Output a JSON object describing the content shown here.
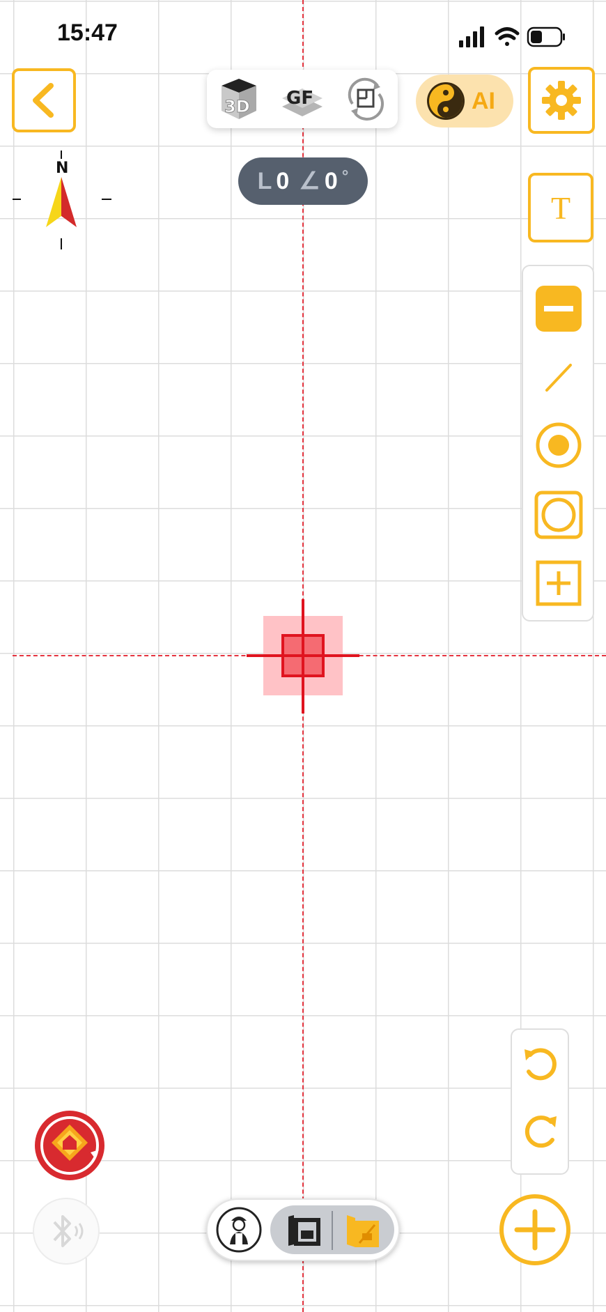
{
  "status_bar": {
    "time": "15:47",
    "icons": [
      "signal-icon",
      "wifi-icon",
      "battery-icon"
    ]
  },
  "header": {
    "back_icon": "chevron-left-icon",
    "modes": [
      {
        "name": "3d-view",
        "label": "3D"
      },
      {
        "name": "gf-view",
        "label": "GF"
      },
      {
        "name": "floorplan-rotate",
        "label": ""
      }
    ],
    "ai_label": "AI",
    "settings_icon": "gear-icon"
  },
  "compass": {
    "north_label": "N"
  },
  "measurement": {
    "length_symbol": "L",
    "length_value": "0",
    "angle_symbol": "∠",
    "angle_value": "0",
    "degree_symbol": "°"
  },
  "text_tool_label": "T",
  "tools": [
    "minus-tool",
    "line-tool",
    "point-tool",
    "circle-tool",
    "add-tool"
  ],
  "undo_redo": [
    "undo-icon",
    "redo-icon"
  ],
  "colors": {
    "accent": "#f8b821",
    "guide": "#e5343f",
    "grid": "#dcdcdc",
    "measure_bg": "#56606e"
  }
}
